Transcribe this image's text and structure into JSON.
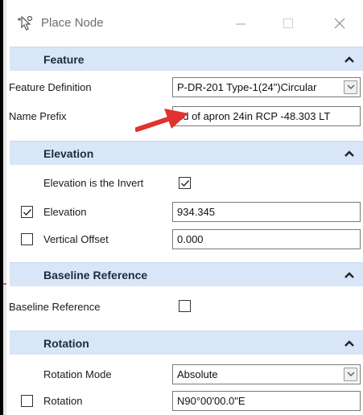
{
  "window": {
    "title": "Place Node",
    "minimize_icon": "minimize-icon",
    "maximize_icon": "maximize-icon",
    "close_icon": "close-icon"
  },
  "sections": {
    "feature": {
      "title": "Feature",
      "feature_definition_label": "Feature Definition",
      "feature_definition_value": "P-DR-201 Type-1(24\")Circular",
      "name_prefix_label": "Name Prefix",
      "name_prefix_value": "nd of apron 24in RCP -48.303 LT"
    },
    "elevation": {
      "title": "Elevation",
      "invert_label": "Elevation is the Invert",
      "invert_checked": true,
      "elevation_label": "Elevation",
      "elevation_checked": true,
      "elevation_value": "934.345",
      "vertical_offset_label": "Vertical Offset",
      "vertical_offset_checked": false,
      "vertical_offset_value": "0.000"
    },
    "baseline": {
      "title": "Baseline Reference",
      "baseline_label": "Baseline Reference",
      "baseline_checked": false
    },
    "rotation": {
      "title": "Rotation",
      "rotation_mode_label": "Rotation Mode",
      "rotation_mode_value": "Absolute",
      "rotation_label": "Rotation",
      "rotation_checked": false,
      "rotation_value": "N90°00'00.0\"E"
    }
  },
  "colors": {
    "section_header_bg": "#d8e6f7",
    "annotation_arrow": "#e0322e"
  }
}
